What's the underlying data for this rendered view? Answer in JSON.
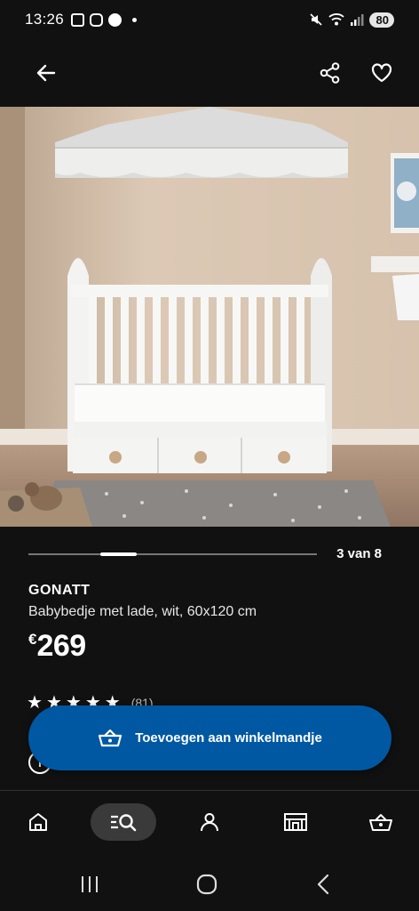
{
  "status_bar": {
    "time": "13:26",
    "left_icons": [
      "mail-icon",
      "instagram-icon",
      "facebook-icon",
      "dot"
    ],
    "right_icons": [
      "mute-icon",
      "wifi-icon",
      "signal-icon"
    ],
    "battery": "80"
  },
  "header": {
    "back_icon": "arrow-left-icon",
    "share_icon": "share-icon",
    "favorite_icon": "heart-icon"
  },
  "gallery": {
    "counter": "3 van 8",
    "progress": {
      "current": 3,
      "total": 8
    }
  },
  "product": {
    "name": "GONATT",
    "description": "Babybedje met lade, wit, 60x120 cm",
    "currency": "€",
    "price": "269",
    "rating": 4.5,
    "rating_count": "(81)"
  },
  "cart_button": {
    "label": "Toevoegen aan winkelmandje",
    "icon": "basket-icon"
  },
  "bottom_nav": {
    "items": [
      {
        "name": "home",
        "icon": "home-icon",
        "active": false
      },
      {
        "name": "search",
        "icon": "search-icon",
        "active": true
      },
      {
        "name": "profile",
        "icon": "user-icon",
        "active": false
      },
      {
        "name": "stores",
        "icon": "store-icon",
        "active": false
      },
      {
        "name": "basket",
        "icon": "basket-icon",
        "active": false
      }
    ]
  },
  "colors": {
    "background": "#111111",
    "accent": "#0058a3",
    "text": "#ffffff"
  }
}
